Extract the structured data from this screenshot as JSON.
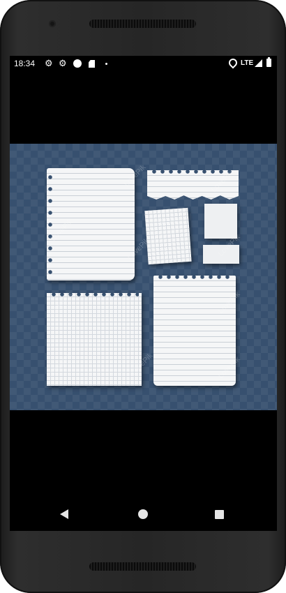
{
  "status_bar": {
    "time": "18:34",
    "network": "LTE",
    "icons": [
      "gear-icon",
      "gear-icon",
      "circle-icon",
      "sd-card-icon",
      "dot-icon",
      "location-icon",
      "signal-icon",
      "battery-icon"
    ]
  },
  "image": {
    "watermark_text": "LovePik"
  },
  "nav": {
    "buttons": [
      "back",
      "home",
      "recents"
    ]
  },
  "colors": {
    "image_background": "#37506f",
    "paper": "#f4f5f6",
    "screen_background": "#000000"
  }
}
